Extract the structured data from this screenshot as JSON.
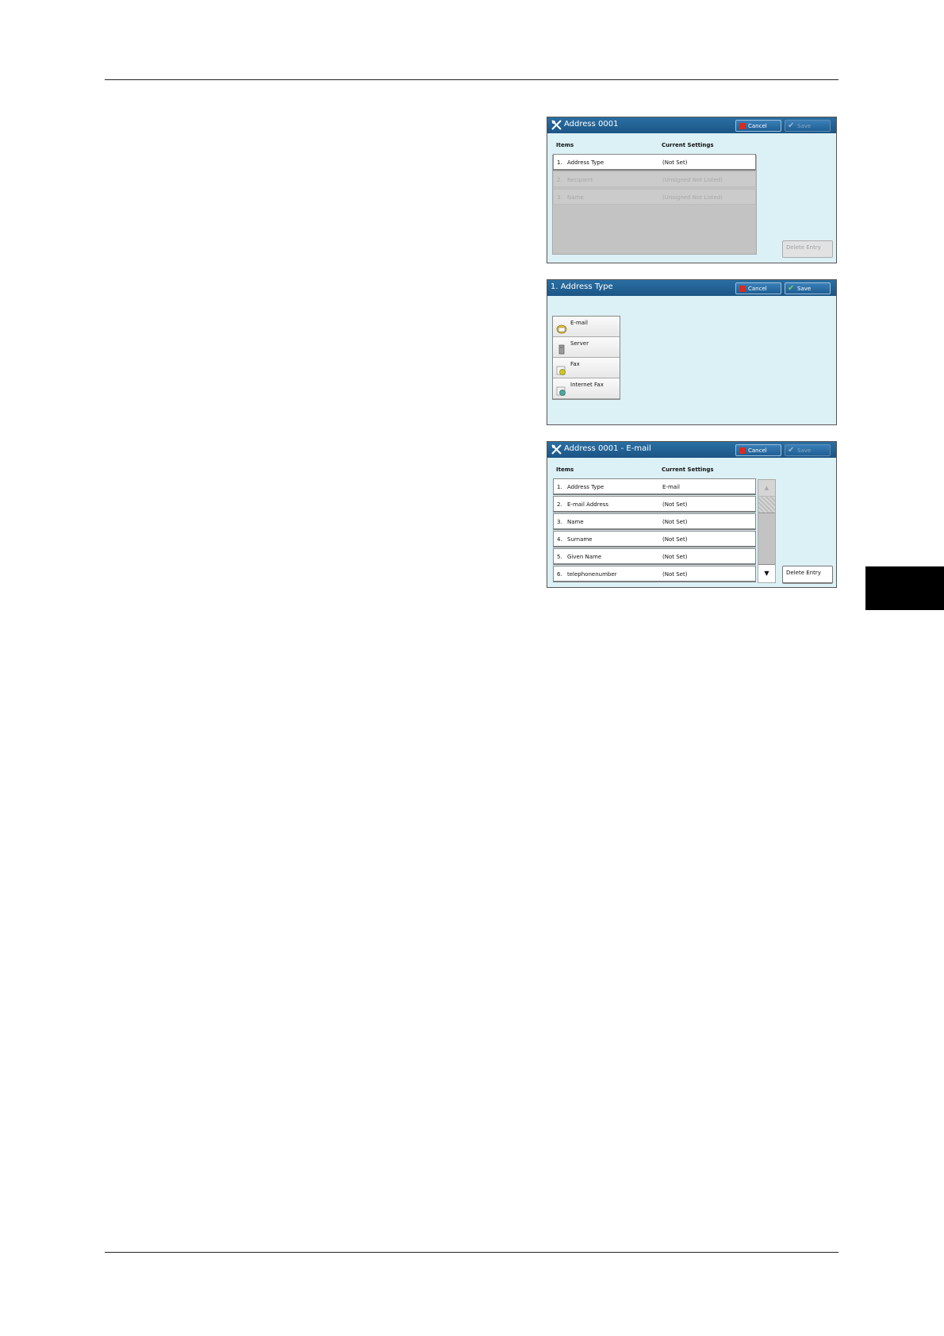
{
  "screen1": {
    "title": "Address 0001",
    "cancel_label": "Cancel",
    "save_label": "Save",
    "col_items": "Items",
    "col_current": "Current Settings",
    "rows": [
      {
        "num": "1.",
        "name": "Address Type",
        "value": "(Not Set)"
      },
      {
        "num": "2.",
        "name": "Recipient",
        "value": "(Unsigned Not Listed)"
      },
      {
        "num": "3.",
        "name": "Name",
        "value": "(Unsigned Not Listed)"
      }
    ],
    "delete_label": "Delete Entry"
  },
  "screen2": {
    "title": "1. Address Type",
    "cancel_label": "Cancel",
    "save_label": "Save",
    "types": [
      {
        "label": "E-mail",
        "icon": "email-icon"
      },
      {
        "label": "Server",
        "icon": "server-icon"
      },
      {
        "label": "Fax",
        "icon": "fax-icon"
      },
      {
        "label": "Internet Fax",
        "icon": "internet-fax-icon"
      }
    ]
  },
  "screen3": {
    "title": "Address 0001 - E-mail",
    "cancel_label": "Cancel",
    "save_label": "Save",
    "col_items": "Items",
    "col_current": "Current Settings",
    "rows": [
      {
        "num": "1.",
        "name": "Address Type",
        "value": "E-mail"
      },
      {
        "num": "2.",
        "name": "E-mail Address",
        "value": "(Not Set)"
      },
      {
        "num": "3.",
        "name": "Name",
        "value": "(Not Set)"
      },
      {
        "num": "4.",
        "name": "Surname",
        "value": "(Not Set)"
      },
      {
        "num": "5.",
        "name": "Given Name",
        "value": "(Not Set)"
      },
      {
        "num": "6.",
        "name": "telephonenumber",
        "value": "(Not Set)"
      }
    ],
    "scroll_up": "▲",
    "scroll_down": "▼",
    "delete_label": "Delete Entry"
  }
}
